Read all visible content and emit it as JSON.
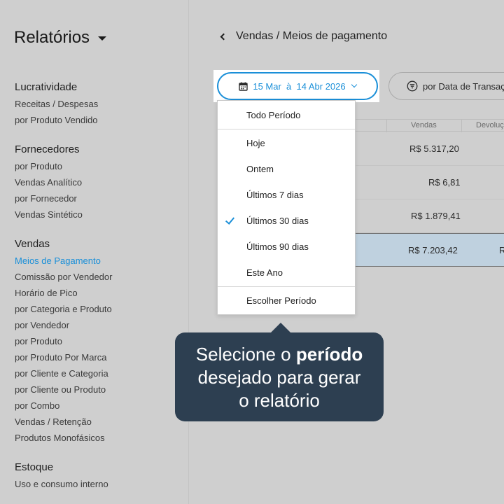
{
  "sidebar": {
    "title": "Relatórios",
    "groups": [
      {
        "heading": "Lucratividade",
        "items": [
          "Receitas / Despesas",
          "por Produto Vendido"
        ]
      },
      {
        "heading": "Fornecedores",
        "items": [
          "por Produto",
          "Vendas Analítico",
          "por Fornecedor",
          "Vendas Sintético"
        ]
      },
      {
        "heading": "Vendas",
        "items": [
          "Meios de Pagamento",
          "Comissão por Vendedor",
          "Horário de Pico",
          "por Categoria e Produto",
          "por Vendedor",
          "por Produto",
          "por Produto Por Marca",
          "por Cliente e Categoria",
          "por Cliente ou Produto",
          "por Combo",
          "Vendas / Retenção",
          "Produtos Monofásicos"
        ],
        "active_index": 0
      },
      {
        "heading": "Estoque",
        "items": [
          "Uso e consumo interno"
        ]
      }
    ]
  },
  "header": {
    "breadcrumb": "Vendas / Meios de pagamento"
  },
  "date_filter": {
    "label": "15 Mar  à  14 Abr 2026"
  },
  "secondary_filter": {
    "label": "por Data de Transação"
  },
  "table": {
    "columns": [
      "Vendas",
      "Devoluções"
    ],
    "rows": [
      {
        "vendas": "R$ 5.317,20",
        "devolucoes": ""
      },
      {
        "vendas": "R$ 6,81",
        "devolucoes": ""
      },
      {
        "vendas": "R$ 1.879,41",
        "devolucoes": ""
      },
      {
        "vendas": "R$ 7.203,42",
        "devolucoes": "R"
      }
    ]
  },
  "dropdown": {
    "options": [
      "Todo Período",
      "Hoje",
      "Ontem",
      "Últimos 7 dias",
      "Últimos 30 dias",
      "Últimos 90 dias",
      "Este Ano",
      "Escolher Período"
    ],
    "selected": "Últimos 30 dias"
  },
  "tooltip": {
    "line1_pre": "Selecione o ",
    "line1_bold": "período",
    "line2": "desejado para gerar",
    "line3": "o relatório"
  },
  "colors": {
    "accent": "#1a8fd8",
    "tooltip_bg": "#2d3f51",
    "selected_row": "#bfd1df"
  }
}
